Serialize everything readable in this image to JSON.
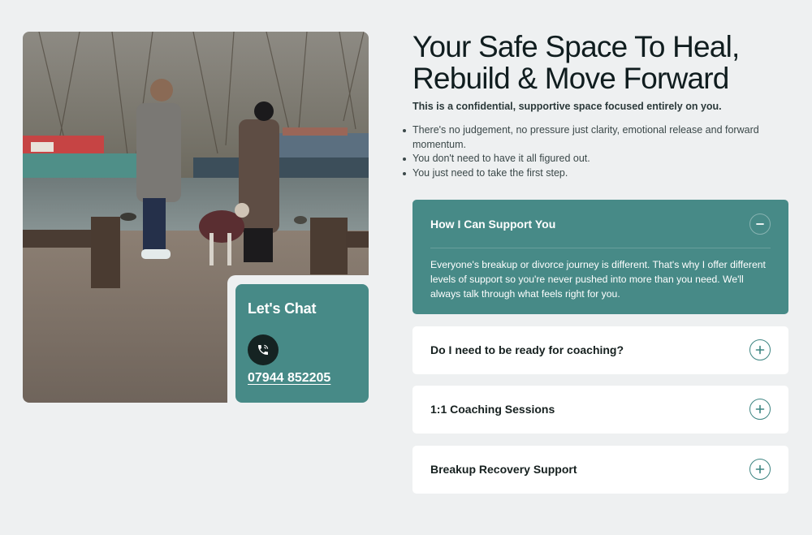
{
  "hero": {
    "headline_line1": "Your Safe Space To Heal,",
    "headline_line2": "Rebuild & Move Forward",
    "subhead": "This is a confidential, supportive space focused entirely on you.",
    "bullets": [
      "There's no judgement, no pressure just clarity, emotional release and forward momentum.",
      "You don't need to have it all figured out.",
      "You just need to take the first step."
    ]
  },
  "photo": {
    "icon": "photo-two-people-by-canal"
  },
  "chat": {
    "title": "Let's Chat",
    "phone": "07944 852205",
    "icon": "phone-icon",
    "bg_color": "#478a87"
  },
  "accordion": {
    "open_item": {
      "title": "How I Can Support You",
      "body": "Everyone's breakup or divorce journey is different. That's why I offer different levels of support so you're never pushed into more than you need. We'll always talk through what feels right for you.",
      "icon": "minus-icon"
    },
    "items": [
      {
        "title": "Do I need to be ready for coaching?",
        "icon": "plus-icon"
      },
      {
        "title": "1:1 Coaching Sessions",
        "icon": "plus-icon"
      },
      {
        "title": "Breakup Recovery Support",
        "icon": "plus-icon"
      }
    ],
    "accent_color": "#478a87"
  }
}
